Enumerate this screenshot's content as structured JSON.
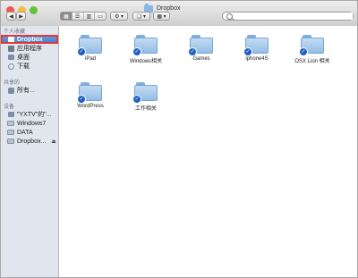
{
  "window": {
    "title": "Dropbox"
  },
  "toolbar": {
    "back_icon": "◀",
    "forward_icon": "▶",
    "view_icons": [
      "▦",
      "☰",
      "▥",
      "▭"
    ],
    "gear_icon": "⚙ ▾",
    "dropbox_icon": "❑ ▾",
    "arrange_icon": "▦ ▾"
  },
  "search": {
    "value": "",
    "placeholder": ""
  },
  "sidebar": {
    "sections": [
      {
        "title": "个人收藏",
        "items": [
          {
            "label": "Dropbox",
            "selected": true
          },
          {
            "label": "应用程序",
            "selected": false
          },
          {
            "label": "桌面",
            "selected": false
          },
          {
            "label": "下载",
            "selected": false
          }
        ]
      },
      {
        "title": "共享的",
        "items": [
          {
            "label": "所有...",
            "selected": false
          }
        ]
      },
      {
        "title": "设备",
        "items": [
          {
            "label": "\"YXTV\"的\"...",
            "selected": false
          },
          {
            "label": "Windows7",
            "selected": false
          },
          {
            "label": "DATA",
            "selected": false
          },
          {
            "label": "Dropbox...",
            "selected": false,
            "eject": "⏏"
          }
        ]
      }
    ]
  },
  "content": {
    "items": [
      {
        "label": "iPad",
        "icon": "folder-dropbox-icon"
      },
      {
        "label": "Windows相关",
        "icon": "folder-dropbox-icon"
      },
      {
        "label": "Games",
        "icon": "folder-dropbox-icon"
      },
      {
        "label": "iphone4S",
        "icon": "folder-dropbox-icon"
      },
      {
        "label": "OSX Lion 相关",
        "icon": "folder-dropbox-icon"
      },
      {
        "label": "WordPress",
        "icon": "folder-dropbox-icon"
      },
      {
        "label": "工作相关",
        "icon": "folder-dropbox-icon"
      }
    ]
  }
}
